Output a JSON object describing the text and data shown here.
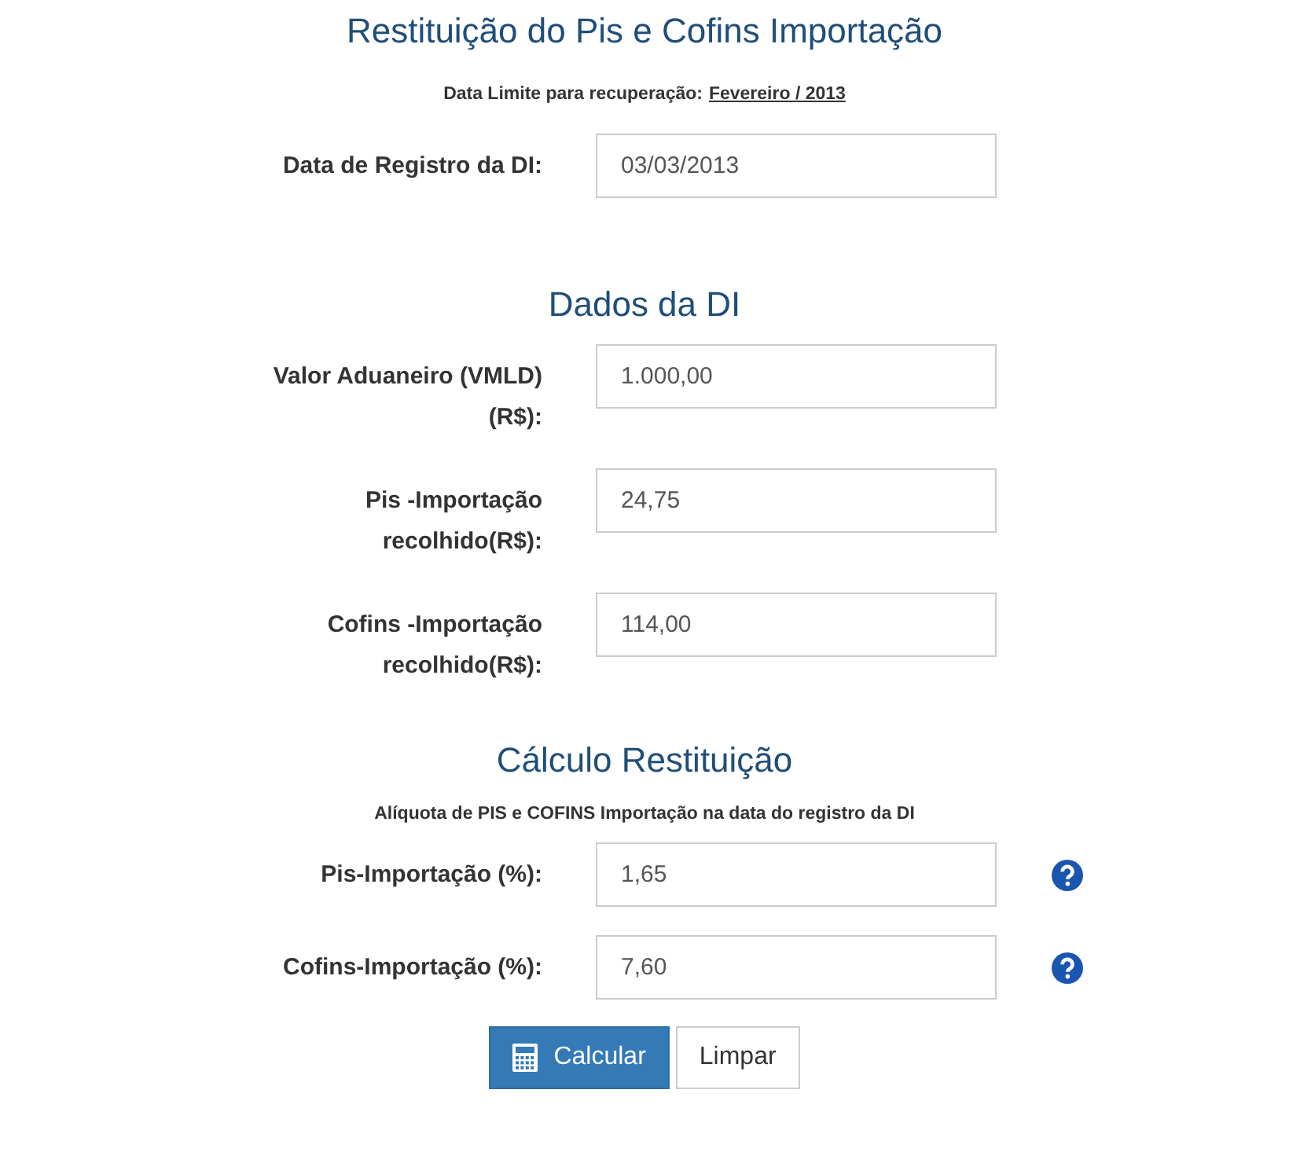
{
  "title": "Restituição do Pis e Cofins Importação",
  "deadline": {
    "label": "Data Limite para recuperação:",
    "value": "Fevereiro / 2013"
  },
  "registration": {
    "label": "Data de Registro da DI:",
    "value": "03/03/2013"
  },
  "sections": [
    {
      "title": "Dados da DI",
      "fields": [
        {
          "label": "Valor Aduaneiro (VMLD) (R$):",
          "value": "1.000,00",
          "help": false
        },
        {
          "label": "Pis -Importação recolhido(R$):",
          "value": "24,75",
          "help": false
        },
        {
          "label": "Cofins -Importação recolhido(R$):",
          "value": "114,00",
          "help": false
        }
      ]
    },
    {
      "title": "Cálculo Restituição",
      "note": "Alíquota de PIS e COFINS Importação na data do registro da DI",
      "fields": [
        {
          "label": "Pis-Importação (%):",
          "value": "1,65",
          "help": true
        },
        {
          "label": "Cofins-Importação (%):",
          "value": "7,60",
          "help": true
        }
      ]
    }
  ],
  "buttons": [
    {
      "label": "Calcular",
      "kind": "primary"
    },
    {
      "label": "Limpar",
      "kind": "default"
    }
  ]
}
